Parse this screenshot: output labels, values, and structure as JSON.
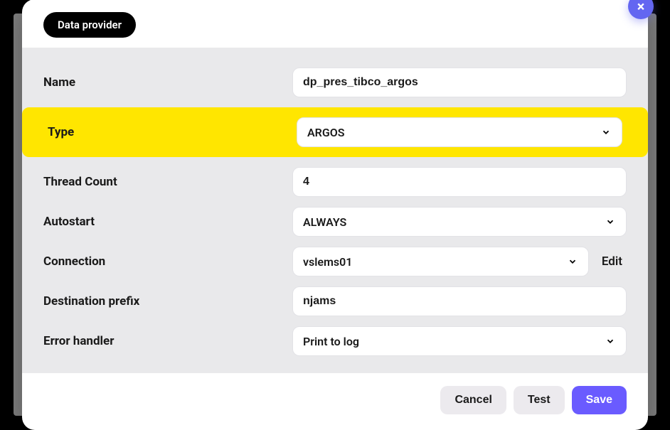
{
  "modal": {
    "title_badge": "Data provider",
    "close_icon": "×"
  },
  "fields": {
    "name": {
      "label": "Name",
      "value": "dp_pres_tibco_argos"
    },
    "type": {
      "label": "Type",
      "value": "ARGOS"
    },
    "thread_count": {
      "label": "Thread Count",
      "value": "4"
    },
    "autostart": {
      "label": "Autostart",
      "value": "ALWAYS"
    },
    "connection": {
      "label": "Connection",
      "value": "vslems01",
      "edit_label": "Edit"
    },
    "destination_prefix": {
      "label": "Destination prefix",
      "value": "njams"
    },
    "error_handler": {
      "label": "Error handler",
      "value": "Print to log"
    }
  },
  "footer": {
    "cancel": "Cancel",
    "test": "Test",
    "save": "Save"
  }
}
